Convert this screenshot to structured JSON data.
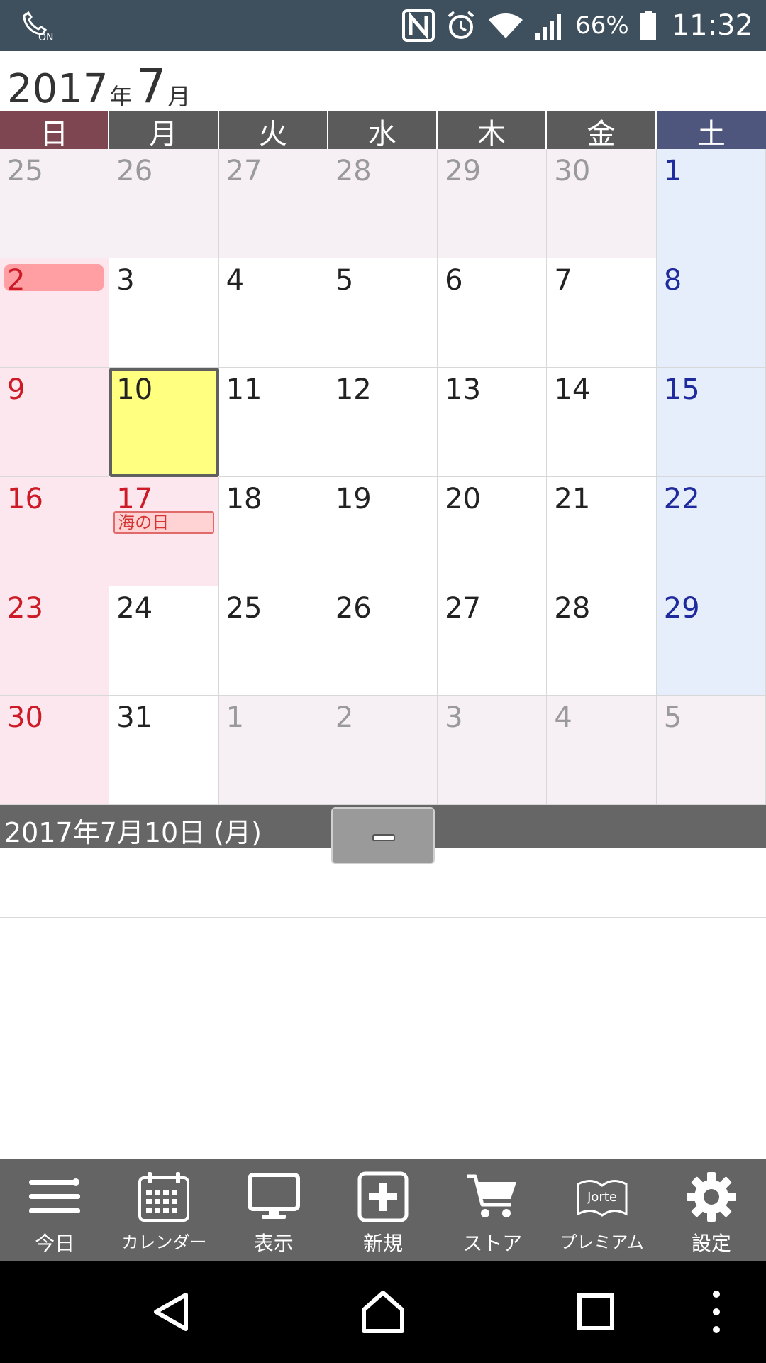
{
  "status_bar": {
    "battery": "66%",
    "time": "11:32",
    "icons": [
      "call-forwarding-on-icon",
      "nfc-icon",
      "alarm-icon",
      "wifi-icon",
      "signal-icon",
      "battery-icon"
    ],
    "left_icon_label": "ON"
  },
  "month_header": {
    "year": "2017",
    "year_unit": "年",
    "month": "7",
    "month_unit": "月"
  },
  "weekdays": [
    "日",
    "月",
    "火",
    "水",
    "木",
    "金",
    "土"
  ],
  "weeks": [
    [
      "25",
      "26",
      "27",
      "28",
      "29",
      "30",
      "1"
    ],
    [
      "2",
      "3",
      "4",
      "5",
      "6",
      "7",
      "8"
    ],
    [
      "9",
      "10",
      "11",
      "12",
      "13",
      "14",
      "15"
    ],
    [
      "16",
      "17",
      "18",
      "19",
      "20",
      "21",
      "22"
    ],
    [
      "23",
      "24",
      "25",
      "26",
      "27",
      "28",
      "29"
    ],
    [
      "30",
      "31",
      "1",
      "2",
      "3",
      "4",
      "5"
    ]
  ],
  "events": {
    "holiday_17": "海の日"
  },
  "selected_date": {
    "label": "2017年7月10日 (月)"
  },
  "toolbar": {
    "items": [
      {
        "label": "今日",
        "icon": "menu-lines-icon"
      },
      {
        "label": "カレンダー",
        "icon": "calendar-icon"
      },
      {
        "label": "表示",
        "icon": "monitor-icon"
      },
      {
        "label": "新規",
        "icon": "add-icon"
      },
      {
        "label": "ストア",
        "icon": "cart-icon"
      },
      {
        "label": "プレミアム",
        "icon": "jorte-premium-icon",
        "badge": "Jorte"
      },
      {
        "label": "設定",
        "icon": "gear-icon"
      }
    ]
  },
  "colors": {
    "status_bar": "#3e4f5d",
    "sunday": "#cc1a26",
    "saturday": "#1f2a9c",
    "today_fill": "#ffff80",
    "toolbar": "#646464"
  }
}
